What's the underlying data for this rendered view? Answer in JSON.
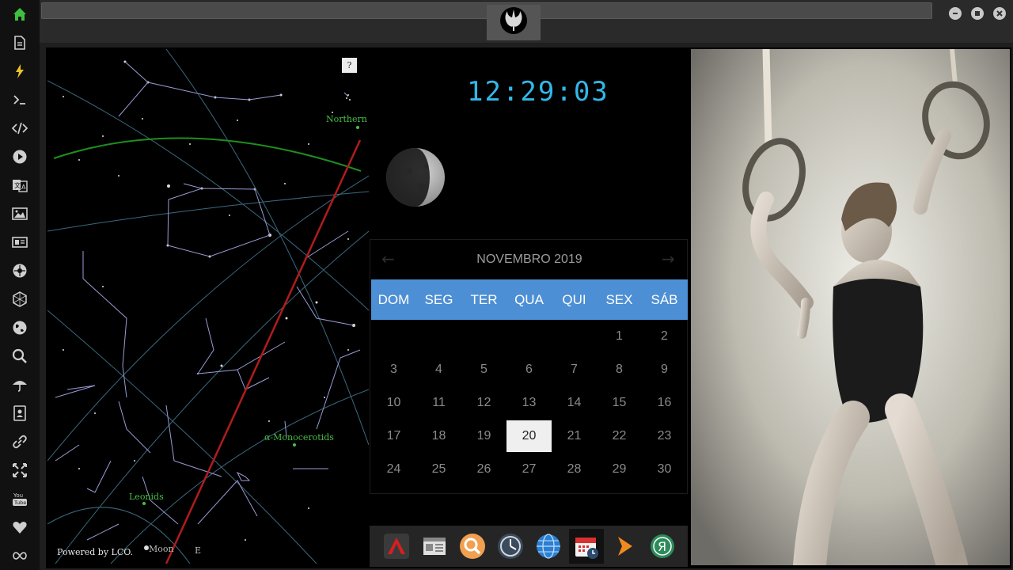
{
  "sidebar": {
    "items": [
      {
        "icon": "home-icon",
        "color": "#3fbf3f"
      },
      {
        "icon": "document-icon",
        "color": "#cfcfcf"
      },
      {
        "icon": "lightning-icon",
        "color": "#e8c32a"
      },
      {
        "icon": "terminal-icon",
        "color": "#cfcfcf"
      },
      {
        "icon": "code-icon",
        "color": "#cfcfcf"
      },
      {
        "icon": "play-icon",
        "color": "#cfcfcf"
      },
      {
        "icon": "translate-icon",
        "color": "#cfcfcf"
      },
      {
        "icon": "image-icon",
        "color": "#cfcfcf"
      },
      {
        "icon": "newspaper-icon",
        "color": "#cfcfcf"
      },
      {
        "icon": "rebel-icon",
        "color": "#cfcfcf"
      },
      {
        "icon": "hexagon-icon",
        "color": "#cfcfcf"
      },
      {
        "icon": "globe-icon",
        "color": "#cfcfcf"
      },
      {
        "icon": "search-icon",
        "color": "#cfcfcf"
      },
      {
        "icon": "umbrella-icon",
        "color": "#cfcfcf"
      },
      {
        "icon": "contacts-icon",
        "color": "#cfcfcf"
      },
      {
        "icon": "link-icon",
        "color": "#cfcfcf"
      },
      {
        "icon": "expand-icon",
        "color": "#cfcfcf"
      },
      {
        "icon": "youtube-icon",
        "color": "#cfcfcf"
      },
      {
        "icon": "heart-icon",
        "color": "#cfcfcf"
      },
      {
        "icon": "infinity-icon",
        "color": "#cfcfcf"
      }
    ]
  },
  "titlebar": {
    "logo_icon": "rebel-alliance-icon",
    "window_buttons": [
      "minimize-icon",
      "maximize-icon",
      "close-icon"
    ]
  },
  "sky_map": {
    "help_label": "?",
    "labels": {
      "northern": "Northern",
      "monocerotids": "α-Monocerotids",
      "leonids": "Leonids",
      "moon": "Moon",
      "east": "E"
    },
    "label_color": "#46c046",
    "credit": "Powered by LCO."
  },
  "clock": {
    "time": "12:29:03",
    "color": "#33b7e8"
  },
  "moon_phase": {
    "icon": "moon-phase-icon",
    "illuminated": "waxing crescent"
  },
  "calendar": {
    "title": "NOVEMBRO 2019",
    "prev": "←",
    "next": "→",
    "weekdays": [
      "DOM",
      "SEG",
      "TER",
      "QUA",
      "QUI",
      "SEX",
      "SÁB"
    ],
    "weeks": [
      [
        "",
        "",
        "",
        "",
        "",
        "1",
        "2"
      ],
      [
        "3",
        "4",
        "5",
        "6",
        "7",
        "8",
        "9"
      ],
      [
        "10",
        "11",
        "12",
        "13",
        "14",
        "15",
        "16"
      ],
      [
        "17",
        "18",
        "19",
        "20",
        "21",
        "22",
        "23"
      ],
      [
        "24",
        "25",
        "26",
        "27",
        "28",
        "29",
        "30"
      ]
    ],
    "today": "20",
    "header_color": "#4d8fd4"
  },
  "dock": {
    "items": [
      {
        "icon": "red-triangle-app-icon",
        "active": false
      },
      {
        "icon": "news-app-icon",
        "active": false
      },
      {
        "icon": "search-app-icon",
        "active": false
      },
      {
        "icon": "clock-app-icon",
        "active": false
      },
      {
        "icon": "globe-app-icon",
        "active": false
      },
      {
        "icon": "calendar-app-icon",
        "active": true
      },
      {
        "icon": "play-arrow-app-icon",
        "active": false
      },
      {
        "icon": "yandex-app-icon",
        "active": false,
        "letter": "Я"
      }
    ]
  },
  "photo": {
    "subject": "gymnast on rings"
  }
}
